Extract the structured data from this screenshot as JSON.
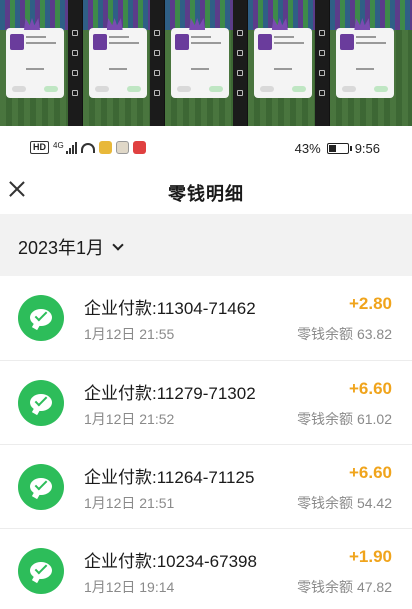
{
  "status_bar": {
    "network_badge": "HD",
    "network_gen": "4G",
    "battery_percent": "43%",
    "battery_level": 0.43,
    "time": "9:56"
  },
  "header": {
    "title": "零钱明细"
  },
  "filter": {
    "month": "2023年1月"
  },
  "transactions": [
    {
      "title": "企业付款:11304-71462",
      "time": "1月12日 21:55",
      "amount": "+2.80",
      "balance": "零钱余额 63.82"
    },
    {
      "title": "企业付款:11279-71302",
      "time": "1月12日 21:52",
      "amount": "+6.60",
      "balance": "零钱余额 61.02"
    },
    {
      "title": "企业付款:11264-71125",
      "time": "1月12日 21:51",
      "amount": "+6.60",
      "balance": "零钱余额 54.42"
    },
    {
      "title": "企业付款:10234-67398",
      "time": "1月12日 19:14",
      "amount": "+1.90",
      "balance": "零钱余额 47.82"
    }
  ],
  "colors": {
    "accent_amount": "#f0a41c",
    "wechat_green": "#2dbd5a",
    "filter_bg": "#f2f2f2"
  },
  "icons": {
    "close": "close-icon",
    "dropdown": "chevron-down-icon",
    "transaction": "wechat-pay-icon"
  }
}
